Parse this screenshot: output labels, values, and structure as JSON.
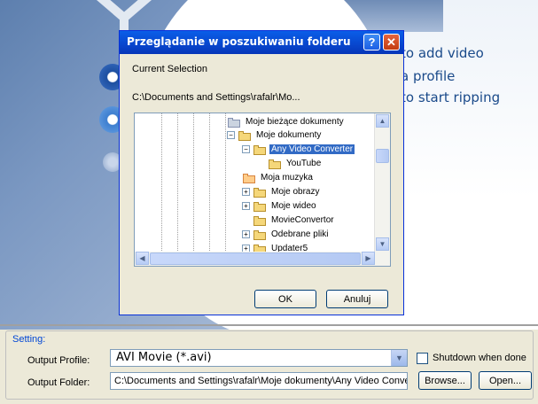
{
  "app": {
    "hints": [
      "to add video",
      "a profile",
      "to start ripping"
    ]
  },
  "dialog": {
    "title": "Przeglądanie w poszukiwaniu folderu",
    "help_glyph": "?",
    "close_glyph": "✕",
    "current_selection_label": "Current Selection",
    "current_path": "C:\\Documents and Settings\\rafalr\\Mo...",
    "tree": [
      {
        "label": "Moje bieżące dokumenty",
        "expander": "",
        "icon": "recent-docs-icon"
      },
      {
        "label": "Moje dokumenty",
        "expander": "−",
        "icon": "folder-open-icon"
      },
      {
        "label": "Any Video Converter",
        "expander": "−",
        "icon": "folder-open-icon",
        "selected": true
      },
      {
        "label": "YouTube",
        "expander": "",
        "icon": "folder-icon"
      },
      {
        "label": "Moja muzyka",
        "expander": "",
        "icon": "music-folder-icon"
      },
      {
        "label": "Moje obrazy",
        "expander": "+",
        "icon": "pictures-folder-icon"
      },
      {
        "label": "Moje wideo",
        "expander": "+",
        "icon": "video-folder-icon"
      },
      {
        "label": "MovieConvertor",
        "expander": "",
        "icon": "folder-icon"
      },
      {
        "label": "Odebrane pliki",
        "expander": "+",
        "icon": "folder-icon"
      },
      {
        "label": "Updater5",
        "expander": "+",
        "icon": "folder-icon"
      }
    ],
    "ok_label": "OK",
    "cancel_label": "Anuluj"
  },
  "setting": {
    "legend": "Setting:",
    "output_profile_label": "Output Profile:",
    "output_profile_value": "AVI Movie (*.avi)",
    "output_folder_label": "Output Folder:",
    "output_folder_value": "C:\\Documents and Settings\\rafalr\\Moje dokumenty\\Any Video Conve",
    "shutdown_label": "Shutdown when done",
    "shutdown_checked": false,
    "browse_label": "Browse...",
    "open_label": "Open..."
  },
  "colors": {
    "title_bar": "#0846cd",
    "selection": "#316ac5",
    "hint_text": "#1a4a8a",
    "legend_text": "#0046d5"
  }
}
